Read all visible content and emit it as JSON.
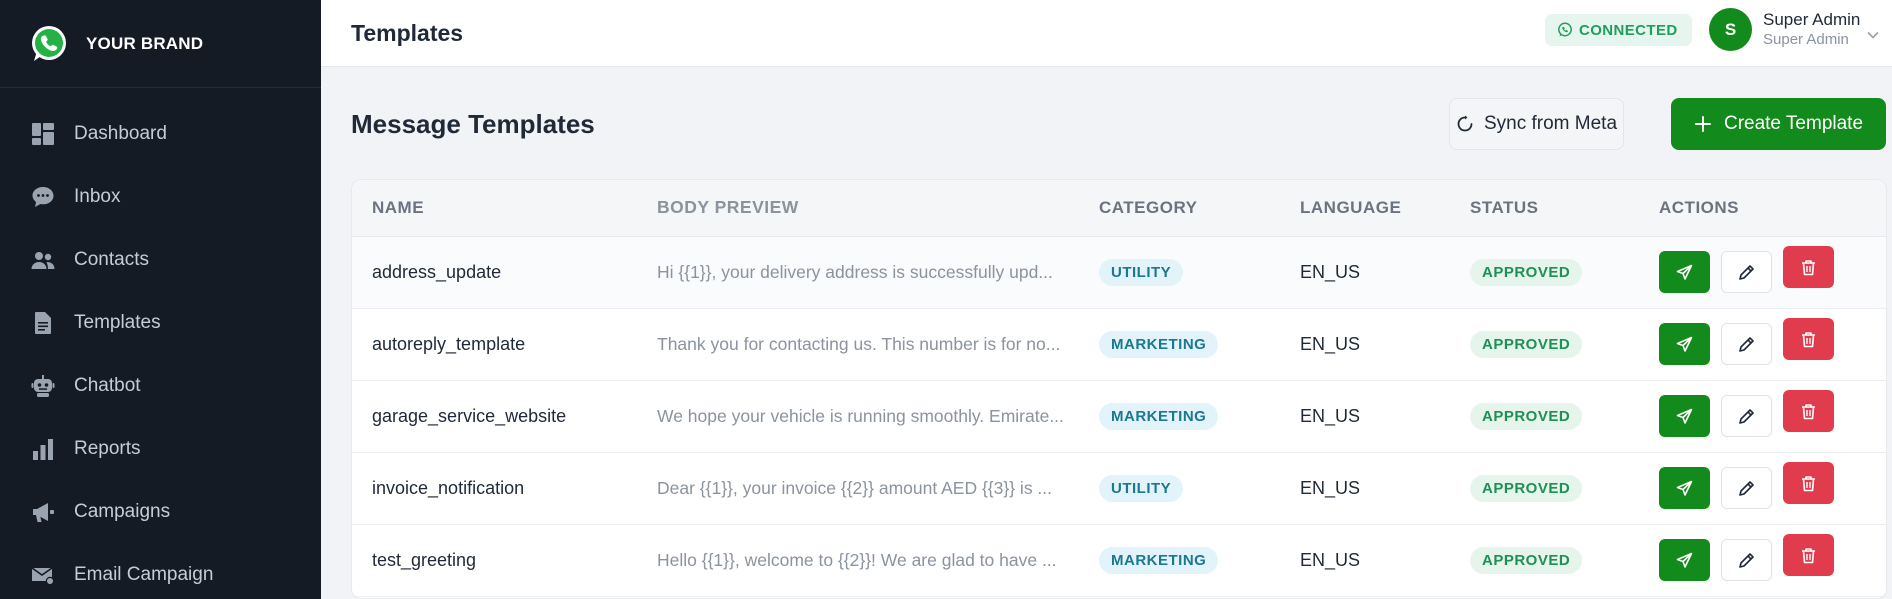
{
  "brand": {
    "name": "YOUR BRAND"
  },
  "sidebar": {
    "items": [
      {
        "label": "Dashboard",
        "icon": "dashboard-icon"
      },
      {
        "label": "Inbox",
        "icon": "chat-bubble-icon"
      },
      {
        "label": "Contacts",
        "icon": "users-icon"
      },
      {
        "label": "Templates",
        "icon": "document-icon"
      },
      {
        "label": "Chatbot",
        "icon": "robot-icon"
      },
      {
        "label": "Reports",
        "icon": "bar-chart-icon"
      },
      {
        "label": "Campaigns",
        "icon": "megaphone-icon"
      },
      {
        "label": "Email Campaign",
        "icon": "envelope-icon"
      }
    ]
  },
  "header": {
    "title": "Templates",
    "connection_status": "CONNECTED",
    "user": {
      "initial": "S",
      "name": "Super Admin",
      "role": "Super Admin"
    }
  },
  "main": {
    "title": "Message Templates",
    "sync_label": "Sync from Meta",
    "create_label": "Create Template",
    "columns": [
      "NAME",
      "BODY PREVIEW",
      "CATEGORY",
      "LANGUAGE",
      "STATUS",
      "ACTIONS"
    ],
    "rows": [
      {
        "name": "address_update",
        "body": "Hi {{1}}, your delivery address is successfully upd...",
        "category": "UTILITY",
        "language": "EN_US",
        "status": "APPROVED"
      },
      {
        "name": "autoreply_template",
        "body": "Thank you for contacting us. This number is for no...",
        "category": "MARKETING",
        "language": "EN_US",
        "status": "APPROVED"
      },
      {
        "name": "garage_service_website",
        "body": "We hope your vehicle is running smoothly. Emirate...",
        "category": "MARKETING",
        "language": "EN_US",
        "status": "APPROVED"
      },
      {
        "name": "invoice_notification",
        "body": "Dear {{1}}, your invoice {{2}} amount AED {{3}} is ...",
        "category": "UTILITY",
        "language": "EN_US",
        "status": "APPROVED"
      },
      {
        "name": "test_greeting",
        "body": "Hello {{1}}, welcome to {{2}}! We are glad to have ...",
        "category": "MARKETING",
        "language": "EN_US",
        "status": "APPROVED"
      }
    ]
  },
  "colors": {
    "brand_green": "#138a1c",
    "sidebar_bg": "#141b25",
    "danger": "#e03c4d",
    "connected": "#1f9e5c"
  }
}
